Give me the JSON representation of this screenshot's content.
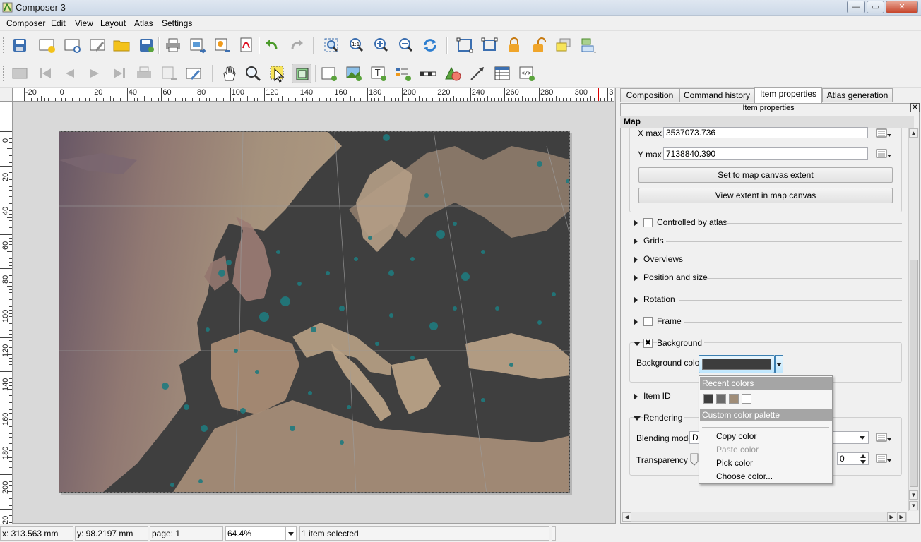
{
  "window": {
    "title": "Composer 3",
    "buttons": {
      "minimize": "—",
      "maximize": "▭",
      "close": "✕"
    }
  },
  "menubar": {
    "items": [
      "Composer",
      "Edit",
      "View",
      "Layout",
      "Atlas",
      "Settings"
    ]
  },
  "toolbar1": {
    "icons": [
      "save-project-icon",
      "new-composer-icon",
      "duplicate-composer-icon",
      "composer-manager-icon",
      "load-template-icon",
      "save-template-icon",
      "print-icon",
      "export-image-icon",
      "export-svg-icon",
      "export-pdf-icon",
      "undo-icon",
      "redo-icon",
      "zoom-full-icon",
      "zoom-actual-icon",
      "zoom-in-icon",
      "zoom-out-icon",
      "refresh-icon",
      "group-icon",
      "ungroup-icon",
      "lock-icon",
      "unlock-icon",
      "raise-icon",
      "align-icon"
    ]
  },
  "toolbar2": {
    "icons": [
      "atlas-preview-icon",
      "first-feature-icon",
      "previous-feature-icon",
      "next-feature-icon",
      "last-feature-icon",
      "print-atlas-icon",
      "export-atlas-icon",
      "atlas-settings-icon",
      "pan-icon",
      "zoom-tool-icon",
      "select-move-icon",
      "move-item-content-icon",
      "add-map-icon",
      "add-image-icon",
      "add-label-icon",
      "add-legend-icon",
      "add-scalebar-icon",
      "add-shape-icon",
      "add-arrow-icon",
      "add-table-icon",
      "add-html-icon"
    ]
  },
  "rulers": {
    "h_labels": [
      "-20",
      "0",
      "20",
      "40",
      "60",
      "80",
      "100",
      "120",
      "140",
      "160",
      "180",
      "200",
      "220",
      "240",
      "260",
      "280",
      "300",
      "3"
    ],
    "v_labels": [
      "0",
      "20",
      "40",
      "60",
      "80",
      "100",
      "120",
      "140",
      "160",
      "180",
      "200",
      "220"
    ]
  },
  "tabs": [
    "Composition",
    "Command history",
    "Item properties",
    "Atlas generation"
  ],
  "active_tab": "Item properties",
  "panel": {
    "title": "Item properties",
    "header": "Map",
    "xmax_label": "X max",
    "xmax_value": "3537073.736",
    "ymax_label": "Y max",
    "ymax_value": "7138840.390",
    "set_extent_button": "Set to map canvas extent",
    "view_extent_button": "View extent in map canvas",
    "sections": {
      "controlled_by_atlas": "Controlled by atlas",
      "grids": "Grids",
      "overviews": "Overviews",
      "position_size": "Position and size",
      "rotation": "Rotation",
      "frame": "Frame",
      "background": "Background",
      "item_id": "Item ID",
      "rendering": "Rendering"
    },
    "background_checked": "✖",
    "background_color_label": "Background color",
    "background_color": "#3d3d3d",
    "blending_mode_label": "Blending mode",
    "blending_mode_value": "Da",
    "transparency_label": "Transparency",
    "transparency_value": "0"
  },
  "color_menu": {
    "recent_header": "Recent colors",
    "recent_colors": [
      "#3d3d3d",
      "#6b6b6b",
      "#a08d78",
      "#ffffff"
    ],
    "custom_header": "Custom color palette",
    "items": [
      "Copy color",
      "Paste color",
      "Pick color",
      "Choose color..."
    ],
    "disabled_item": "Paste color"
  },
  "statusbar": {
    "x": "x: 313.563 mm",
    "y": "y: 98.2197 mm",
    "page": "page: 1",
    "zoom": "64.4%",
    "selection": "1 item selected"
  }
}
